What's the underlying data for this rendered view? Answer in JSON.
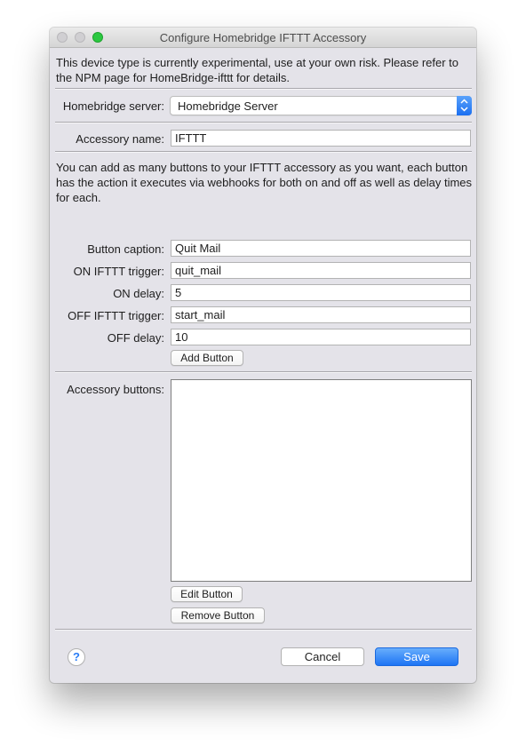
{
  "window": {
    "title": "Configure Homebridge IFTTT Accessory"
  },
  "intro_text": "This device type is currently experimental, use at your own risk.  Please refer to the NPM page for HomeBridge-ifttt for details.",
  "server": {
    "label": "Homebridge server:",
    "selected": "Homebridge Server"
  },
  "accessory": {
    "label": "Accessory name:",
    "value": "IFTTT"
  },
  "buttons_help_text": "You can add as many buttons to your IFTTT accessory as you want, each button has the action it executes via webhooks for both on and off as well as delay times for each.",
  "button_form": {
    "caption_label": "Button caption:",
    "caption_value": "Quit Mail",
    "on_trigger_label": "ON IFTTT trigger:",
    "on_trigger_value": "quit_mail",
    "on_delay_label": "ON delay:",
    "on_delay_value": "5",
    "off_trigger_label": "OFF IFTTT trigger:",
    "off_trigger_value": "start_mail",
    "off_delay_label": "OFF delay:",
    "off_delay_value": "10",
    "add_label": "Add Button"
  },
  "accessory_buttons": {
    "label": "Accessory buttons:",
    "items": [],
    "edit_label": "Edit Button",
    "remove_label": "Remove Button"
  },
  "footer": {
    "help_label": "?",
    "cancel_label": "Cancel",
    "save_label": "Save"
  },
  "colors": {
    "window_bg": "#e4e3e9",
    "accent": "#1d74f4",
    "zoom_green": "#2bc840"
  }
}
